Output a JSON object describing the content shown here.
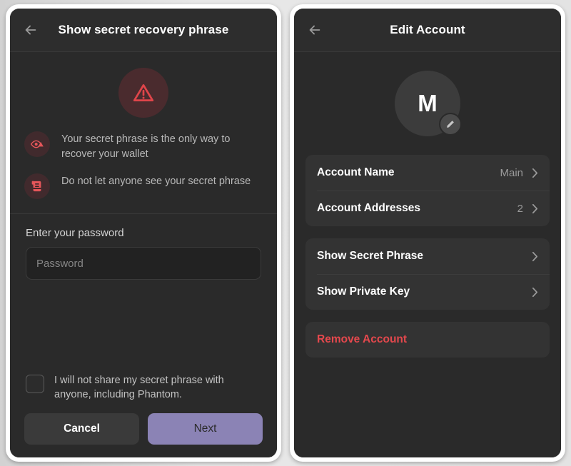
{
  "theme": {
    "page_bg": "#dddddd",
    "panel_bg": "#2a2a2a",
    "header_bg": "#2d2d2d",
    "card_bg": "#333333",
    "accent_purple": "#8b83b5",
    "danger_red": "#e5484d",
    "warn_circle_bg": "#4a2b2e",
    "text_primary": "#ffffff",
    "text_secondary": "#b9b9b9"
  },
  "left_panel": {
    "header": {
      "back_icon": "arrow-left-icon",
      "title": "Show secret recovery phrase"
    },
    "hero_icon": "warning-triangle-icon",
    "warnings": [
      {
        "icon": "eye-warning-icon",
        "text": "Your secret phrase is the only way to recover your wallet"
      },
      {
        "icon": "scroll-document-icon",
        "text": "Do not let anyone see your secret phrase"
      }
    ],
    "password": {
      "label": "Enter your password",
      "placeholder": "Password",
      "value": ""
    },
    "agreement": {
      "checked": false,
      "text": "I will not share my secret phrase with anyone, including Phantom."
    },
    "buttons": {
      "cancel_label": "Cancel",
      "next_label": "Next"
    }
  },
  "right_panel": {
    "header": {
      "back_icon": "arrow-left-icon",
      "title": "Edit Account"
    },
    "avatar": {
      "initial": "M",
      "edit_icon": "pencil-icon"
    },
    "groups": [
      {
        "rows": [
          {
            "label": "Account Name",
            "value": "Main",
            "chevron": "chevron-right-icon"
          },
          {
            "label": "Account Addresses",
            "value": "2",
            "chevron": "chevron-right-icon"
          }
        ]
      },
      {
        "rows": [
          {
            "label": "Show Secret Phrase",
            "value": "",
            "chevron": "chevron-right-icon"
          },
          {
            "label": "Show Private Key",
            "value": "",
            "chevron": "chevron-right-icon"
          }
        ]
      },
      {
        "rows": [
          {
            "label": "Remove Account",
            "value": "",
            "chevron": "",
            "danger": true
          }
        ]
      }
    ]
  }
}
